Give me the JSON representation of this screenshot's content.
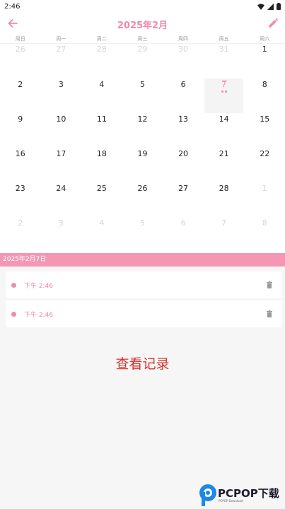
{
  "status_bar": {
    "time": "2:46"
  },
  "header": {
    "title": "2025年2月"
  },
  "calendar": {
    "weekdays": [
      "周日",
      "周一",
      "周二",
      "周三",
      "周四",
      "周五",
      "周六"
    ],
    "weeks": [
      [
        {
          "label": "26",
          "muted": true
        },
        {
          "label": "27",
          "muted": true
        },
        {
          "label": "28",
          "muted": true
        },
        {
          "label": "29",
          "muted": true
        },
        {
          "label": "30",
          "muted": true
        },
        {
          "label": "31",
          "muted": true
        },
        {
          "label": "1",
          "muted": false
        }
      ],
      [
        {
          "label": "2",
          "muted": false
        },
        {
          "label": "3",
          "muted": false
        },
        {
          "label": "4",
          "muted": false
        },
        {
          "label": "5",
          "muted": false
        },
        {
          "label": "6",
          "muted": false
        },
        {
          "label": "7",
          "muted": false,
          "selected": true,
          "dots": 2
        },
        {
          "label": "8",
          "muted": false
        }
      ],
      [
        {
          "label": "9",
          "muted": false
        },
        {
          "label": "10",
          "muted": false
        },
        {
          "label": "11",
          "muted": false
        },
        {
          "label": "12",
          "muted": false
        },
        {
          "label": "13",
          "muted": false
        },
        {
          "label": "14",
          "muted": false
        },
        {
          "label": "15",
          "muted": false
        }
      ],
      [
        {
          "label": "16",
          "muted": false
        },
        {
          "label": "17",
          "muted": false
        },
        {
          "label": "18",
          "muted": false
        },
        {
          "label": "19",
          "muted": false
        },
        {
          "label": "20",
          "muted": false
        },
        {
          "label": "21",
          "muted": false
        },
        {
          "label": "22",
          "muted": false
        }
      ],
      [
        {
          "label": "23",
          "muted": false
        },
        {
          "label": "24",
          "muted": false
        },
        {
          "label": "25",
          "muted": false
        },
        {
          "label": "26",
          "muted": false
        },
        {
          "label": "27",
          "muted": false
        },
        {
          "label": "28",
          "muted": false
        },
        {
          "label": "1",
          "muted": true
        }
      ],
      [
        {
          "label": "2",
          "muted": true
        },
        {
          "label": "3",
          "muted": true
        },
        {
          "label": "4",
          "muted": true
        },
        {
          "label": "5",
          "muted": true
        },
        {
          "label": "6",
          "muted": true
        },
        {
          "label": "7",
          "muted": true
        },
        {
          "label": "8",
          "muted": true
        }
      ]
    ]
  },
  "selected_date": "2025年2月7日",
  "records": [
    {
      "time": "下午 2:46"
    },
    {
      "time": "下午 2:46"
    }
  ],
  "view_records_label": "查看记录",
  "watermark": {
    "brand": "PCPOP下载",
    "sub": "PCPOP Download"
  },
  "colors": {
    "accent": "#ee8aaa",
    "band": "#f497b4",
    "action": "#d8312c"
  },
  "icons": [
    "back-arrow-icon",
    "pencil-icon",
    "trash-icon",
    "wifi-icon",
    "signal-icon",
    "battery-icon"
  ]
}
